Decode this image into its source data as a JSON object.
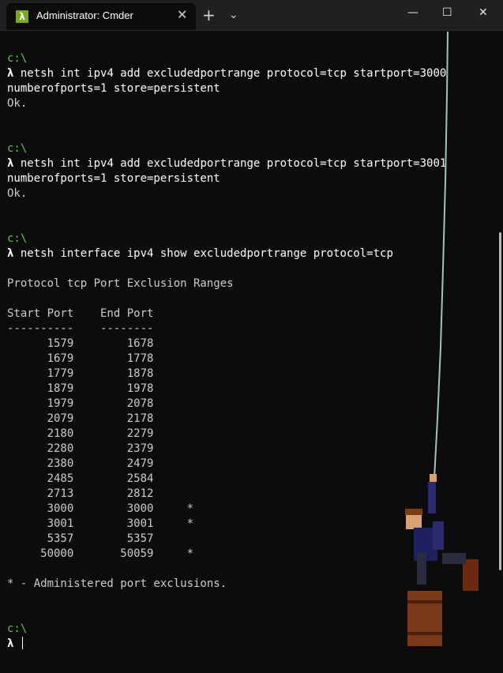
{
  "window": {
    "tab_title": "Administrator: Cmder",
    "tab_icon": "λ",
    "close_tab": "✕",
    "new_tab": "+",
    "dropdown": "⌄",
    "minimize": "—",
    "maximize": "☐",
    "close": "✕"
  },
  "terminal": {
    "prompt_path": "c:\\",
    "lambda": "λ",
    "cmd1_line1": " netsh int ipv4 add excludedportrange protocol=tcp startport=3000",
    "cmd1_line2": "numberofports=1 store=persistent",
    "ok1": "Ok.",
    "cmd2_line1": " netsh int ipv4 add excludedportrange protocol=tcp startport=3001",
    "cmd2_line2": "numberofports=1 store=persistent",
    "ok2": "Ok.",
    "cmd3": " netsh interface ipv4 show excludedportrange protocol=tcp",
    "heading": "Protocol tcp Port Exclusion Ranges",
    "col_header": "Start Port    End Port",
    "col_rule": "----------    --------",
    "rows": [
      "      1579        1678",
      "      1679        1778",
      "      1779        1878",
      "      1879        1978",
      "      1979        2078",
      "      2079        2178",
      "      2180        2279",
      "      2280        2379",
      "      2380        2479",
      "      2485        2584",
      "      2713        2812",
      "      3000        3000     *",
      "      3001        3001     *",
      "      5357        5357",
      "     50000       50059     *"
    ],
    "footnote": "* - Administered port exclusions."
  },
  "colors": {
    "background": "#0c0c0c",
    "prompt": "#59c84a",
    "text": "#cccccc"
  }
}
